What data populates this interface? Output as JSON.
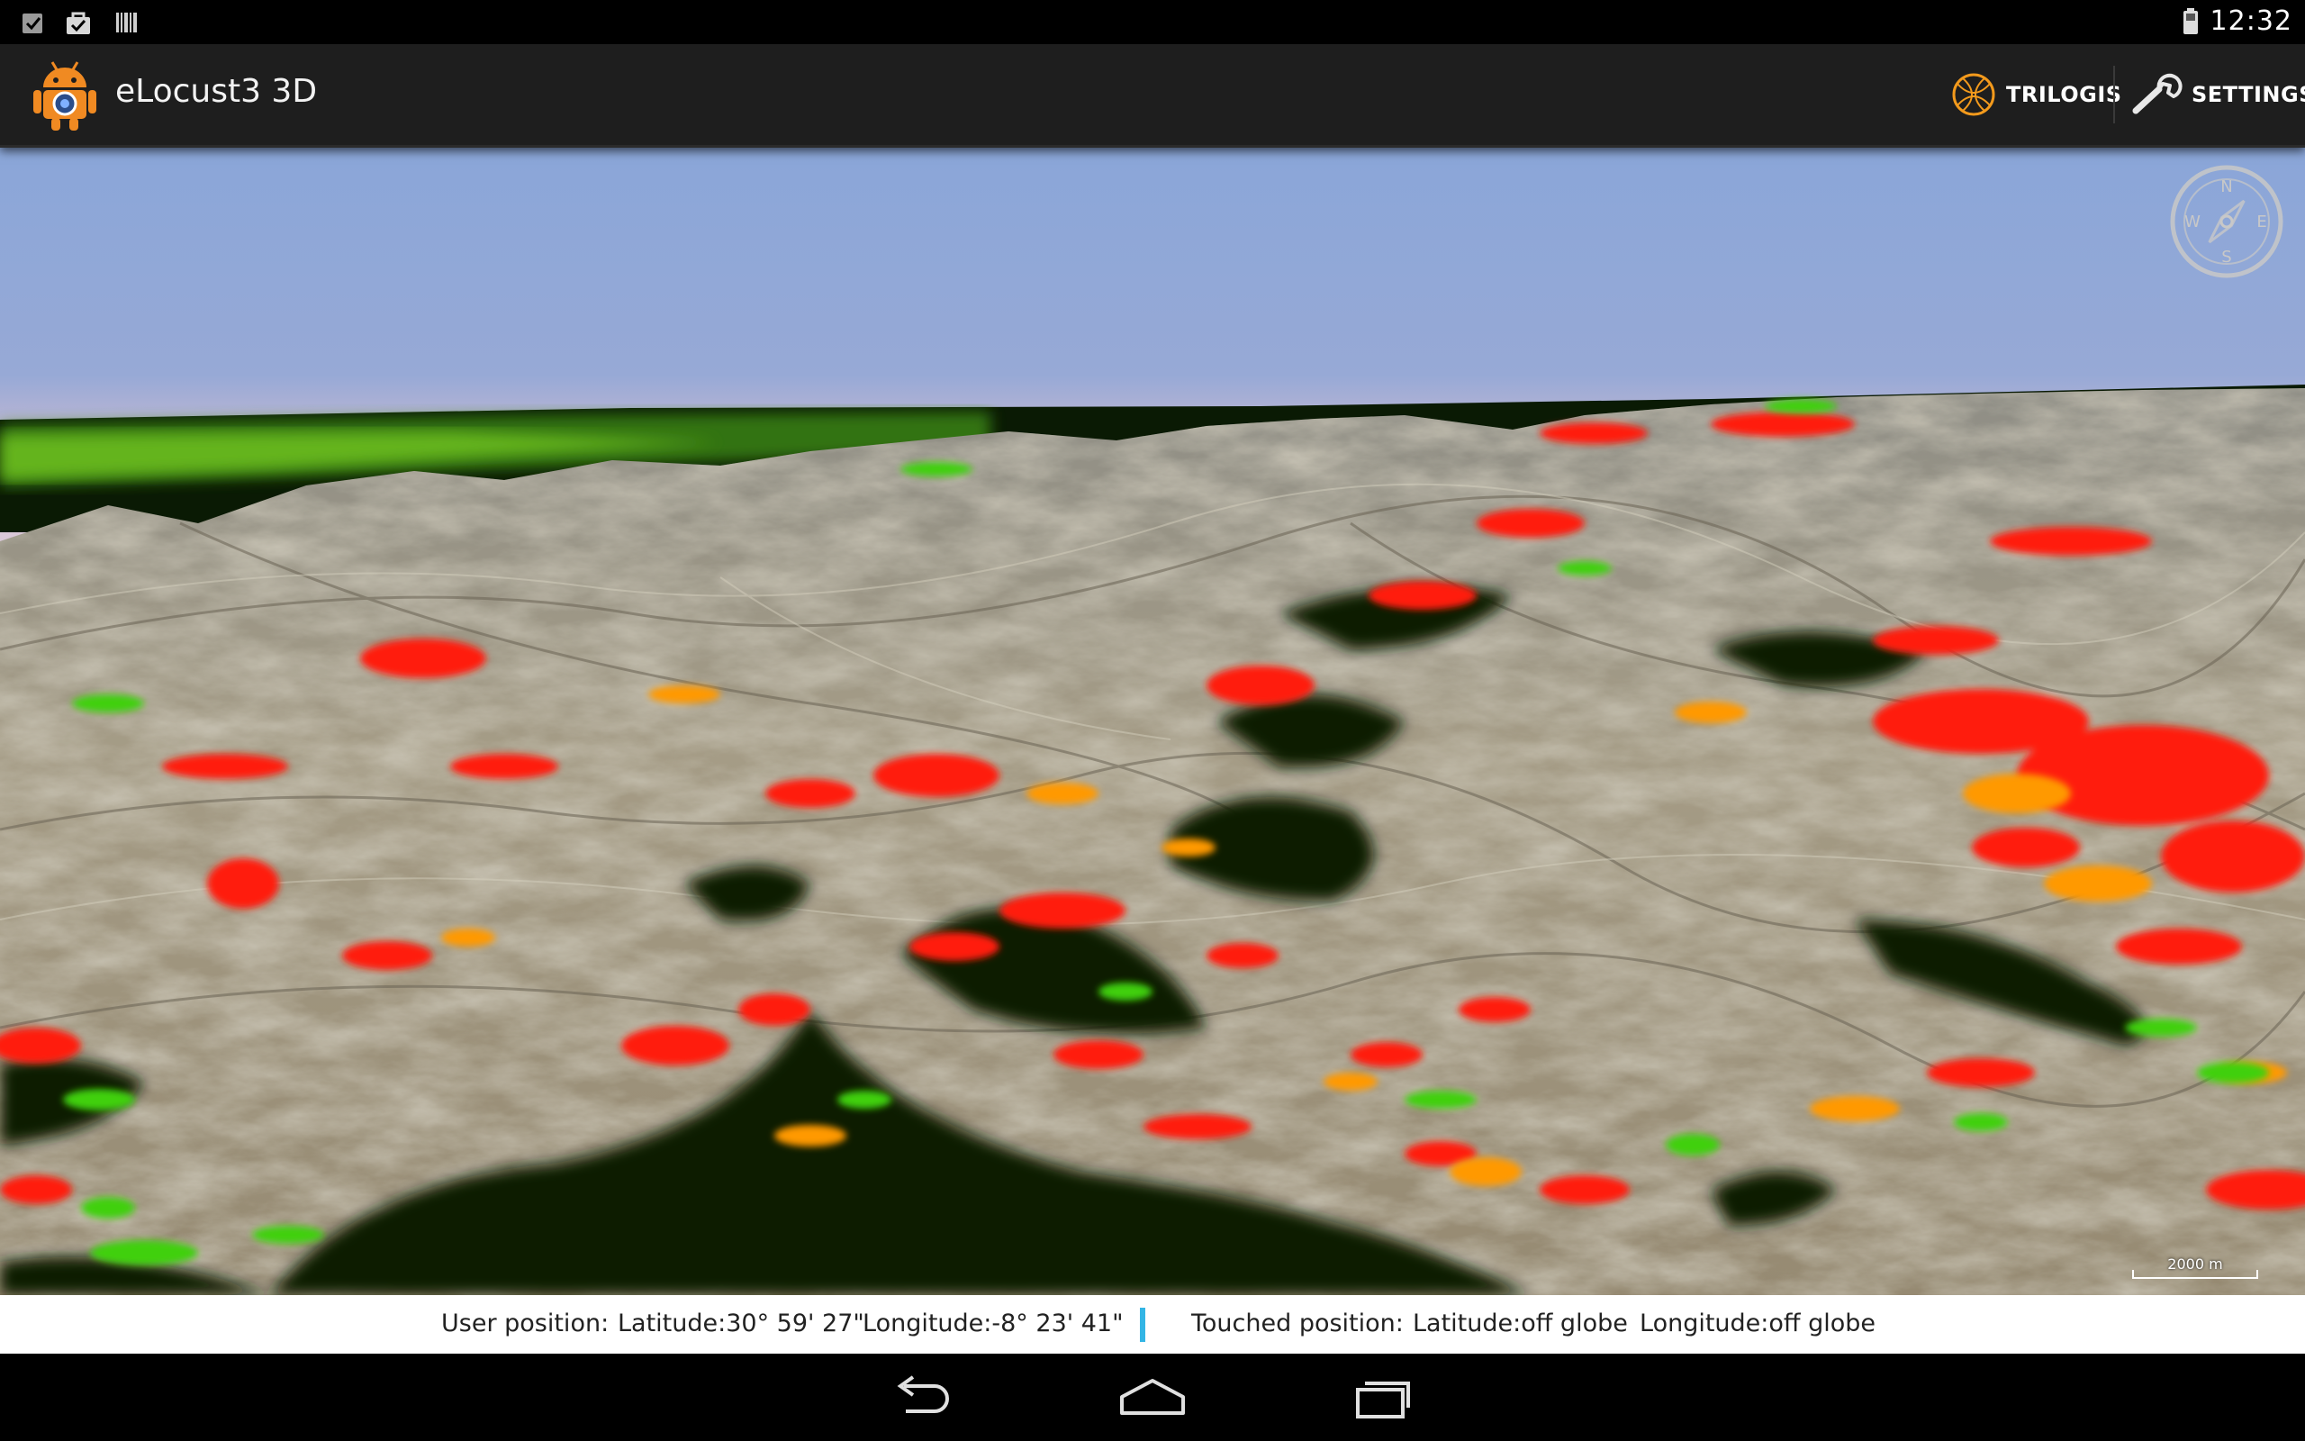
{
  "status_bar": {
    "time": "12:32",
    "icons": [
      "checkbox-notification-icon",
      "shopping-bag-icon",
      "barcode-icon"
    ],
    "battery_icon": "battery-icon"
  },
  "action_bar": {
    "app_icon": "android-robot-icon",
    "title": "eLocust3 3D",
    "actions": [
      {
        "label": "TRILOGIS",
        "icon": "trilogis-globe-icon"
      },
      {
        "label": "SETTINGS",
        "icon": "wrench-icon"
      }
    ]
  },
  "map": {
    "compass": {
      "n": "N",
      "e": "E",
      "s": "S",
      "w": "W"
    },
    "scale_label": "2000 m"
  },
  "info_bar": {
    "user_label": "User position:",
    "user_lat": "Latitude:30° 59' 27\"",
    "user_lon": "Longitude:-8° 23' 41\"",
    "touched_label": "Touched position:",
    "touched_lat": "Latitude:off globe",
    "touched_lon": "Longitude:off globe"
  },
  "nav_bar": {
    "buttons": [
      "back-icon",
      "home-icon",
      "recents-icon"
    ]
  },
  "colors": {
    "accent": "#33b5e5",
    "heat_red": "#ff1a0a",
    "heat_orange": "#ff9900",
    "heat_green": "#40d010",
    "heat_dark": "#0a1a04",
    "terrain": "#9c927c"
  }
}
